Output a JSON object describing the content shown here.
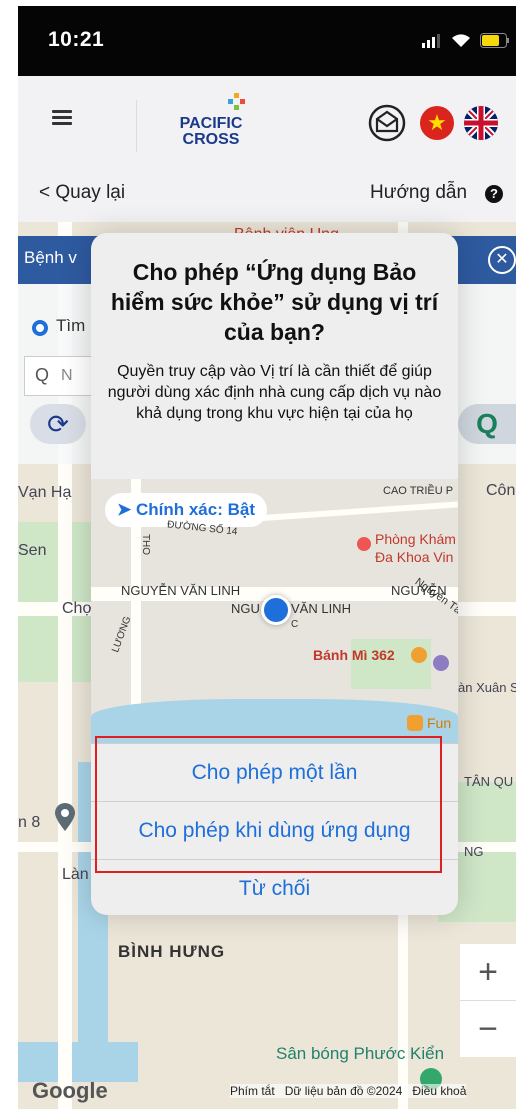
{
  "status_bar": {
    "time": "10:21"
  },
  "header": {
    "brand_line1": "PACIFIC",
    "brand_line2": "CROSS",
    "accent_color": "#1c3a8c"
  },
  "nav": {
    "back_label": "< Quay lại",
    "guide_label": "Hướng dẫn"
  },
  "map": {
    "labels": {
      "hospital": "Bệnh viện Ung",
      "van_hanh": "Vạn Hạ",
      "sen": "Sen",
      "cho": "Chợ",
      "an8": "n 8",
      "lan": "Làn",
      "binh_hung": "BÌNH HƯNG",
      "san_bong": "Sân bóng Phước Kiển",
      "cong": "Công V",
      "tan_qu": "TÂN QU",
      "ng": "NG",
      "an_xuan": "àn Xuân S"
    },
    "footer": {
      "google": "Google",
      "shortcuts": "Phím tắt",
      "map_data": "Dữ liệu bản đồ ©2024",
      "terms": "Điều khoả"
    }
  },
  "panel": {
    "title": "Bệnh v",
    "radio_label": "Tìm",
    "search_placeholder": "N"
  },
  "dialog": {
    "title": "Cho phép “Ứng dụng Bảo hiểm sức khỏe” sử dụng vị trí của bạn?",
    "message": "Quyền truy cập vào Vị trí là cần thiết để giúp người dùng xác định nhà cung cấp dịch vụ nào khả dụng trong khu vực hiện tại của họ",
    "precise_label": "Chính xác: Bật",
    "minimap_labels": {
      "cao_trieu": "CAO TRIỀU P",
      "duong_so_14": "ĐƯỜNG SỐ 14",
      "phong_kham": "Phòng Khám",
      "da_khoa": "Đa Khoa Vin",
      "nvl1": "NGUYỄN VĂN LINH",
      "nvl2": "NGUYỄN",
      "nvl3": "NGU",
      "nvl4": "VĂN LINH",
      "banh_mi": "Bánh Mì 362",
      "fun": "Fun",
      "tho": "THO",
      "luong": "LƯƠNG",
      "nguyen_tat": "Nguyễn Tất",
      "c": "C"
    },
    "btn_once": "Cho phép một lần",
    "btn_while_using": "Cho phép khi dùng ứng dụng",
    "btn_deny": "Từ chối"
  }
}
